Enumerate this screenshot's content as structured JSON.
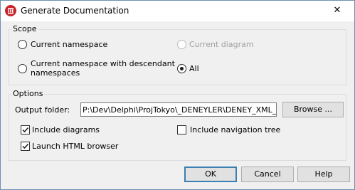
{
  "window": {
    "title": "Generate Documentation",
    "icon": "red-logo-icon",
    "close_label": "✕"
  },
  "scope": {
    "label": "Scope",
    "options": [
      {
        "label": "Current namespace",
        "selected": false,
        "enabled": true
      },
      {
        "label": "Current diagram",
        "selected": false,
        "enabled": false
      },
      {
        "label_line1": "Current namespace with descendant",
        "label_line2": "namespaces",
        "selected": false,
        "enabled": true
      },
      {
        "label": "All",
        "selected": true,
        "enabled": true
      }
    ]
  },
  "options": {
    "label": "Options",
    "output_folder_label": "Output folder:",
    "output_folder_value": "P:\\Dev\\Delphi\\ProjTokyo\\_DENEYLER\\DENEY_XML_I",
    "browse_label": "Browse ...",
    "include_diagrams": {
      "label": "Include diagrams",
      "checked": true
    },
    "include_navigation_tree": {
      "label": "Include navigation tree",
      "checked": false
    },
    "launch_html_browser": {
      "label": "Launch HTML browser",
      "checked": true
    }
  },
  "buttons": {
    "ok": "OK",
    "cancel": "Cancel",
    "help": "Help"
  }
}
